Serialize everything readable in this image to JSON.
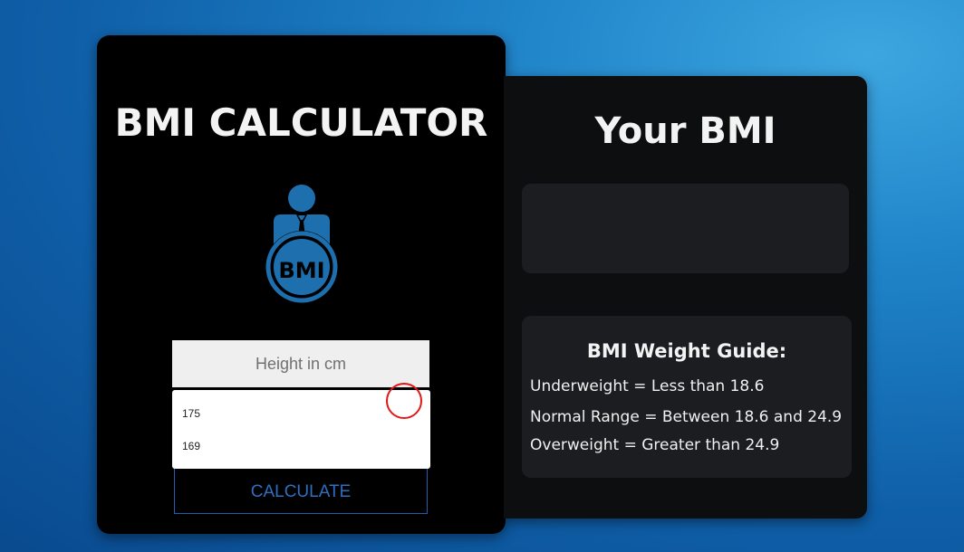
{
  "calculator": {
    "title": "BMI CALCULATOR",
    "logo_icon": "bmi-person-icon",
    "logo_text": "BMI",
    "height_placeholder": "Height in cm",
    "autocomplete_options": [
      "175",
      "169"
    ],
    "calculate_label": "CALCULATE"
  },
  "result": {
    "title": "Your BMI",
    "value": ""
  },
  "guide": {
    "title": "BMI Weight Guide:",
    "lines": [
      "Underweight = Less than 18.6",
      "Normal Range = Between 18.6 and 24.9",
      "Overweight = Greater than 24.9"
    ]
  },
  "colors": {
    "accent": "#1e6fae",
    "button_text": "#2e6fc0",
    "cursor_ring": "#e01818"
  }
}
